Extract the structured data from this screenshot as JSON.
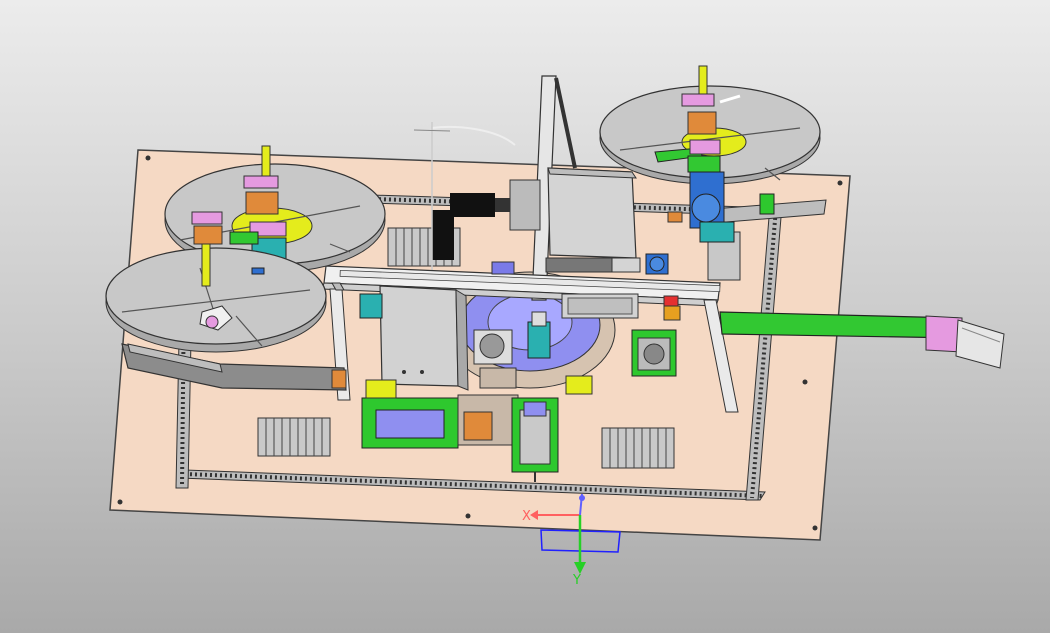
{
  "viewport": {
    "background_top": "#ececec",
    "background_bottom": "#a9a9a9"
  },
  "model": {
    "baseplate_color": "#f5d9c4",
    "reel_color": "#c8c8c8",
    "hub_color": "#e4ec1c",
    "conveyor_color": "#32c832",
    "motor_color": "#2f6fd0",
    "enclosure_color": "#d4d4d4",
    "bracket_colors": [
      "#e59ae0",
      "#e08a3a",
      "#2ab0b0",
      "#7a7ae8"
    ]
  },
  "triad": {
    "x_label": "X",
    "y_label": "Y",
    "x_color": "#ff6060",
    "y_color": "#26d026",
    "z_color": "#6060ff",
    "box_color": "#2020ff"
  }
}
